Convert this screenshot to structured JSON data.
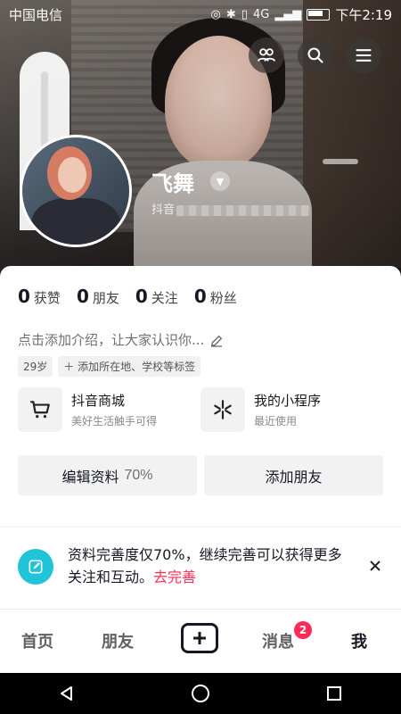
{
  "status_bar": {
    "carrier": "中国电信",
    "time": "下午2:19",
    "network": "4G"
  },
  "header": {
    "name": "飞舞",
    "id_prefix": "抖音"
  },
  "stats": [
    {
      "num": "0",
      "label": "获赞"
    },
    {
      "num": "0",
      "label": "朋友"
    },
    {
      "num": "0",
      "label": "关注"
    },
    {
      "num": "0",
      "label": "粉丝"
    }
  ],
  "bio": {
    "placeholder": "点击添加介绍，让大家认识你..."
  },
  "tags": {
    "age": "29岁",
    "add": "添加所在地、学校等标签"
  },
  "tiles": [
    {
      "title": "抖音商城",
      "sub": "美好生活触手可得"
    },
    {
      "title": "我的小程序",
      "sub": "最近使用"
    }
  ],
  "buttons": {
    "edit": "编辑资料",
    "edit_pct": "70%",
    "add_friend": "添加朋友"
  },
  "banner": {
    "text": "资料完善度仅70%，继续完善可以获得更多关注和互动。",
    "link": "去完善"
  },
  "tabs": {
    "home": "首页",
    "friends": "朋友",
    "messages": "消息",
    "me": "我",
    "messages_badge": "2"
  },
  "colors": {
    "accent": "#fe2c55",
    "banner_icon": "#20c3d8"
  }
}
